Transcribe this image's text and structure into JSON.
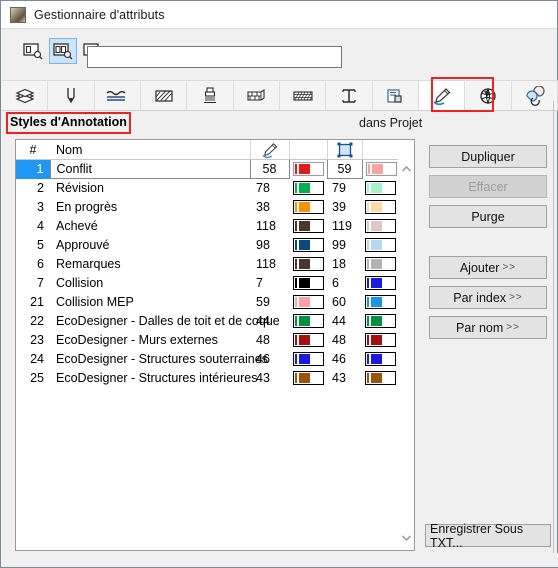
{
  "window": {
    "title": "Gestionnaire d'attributs",
    "app_icon": "archicad-icon"
  },
  "search": {
    "value": "",
    "placeholder": "",
    "modes": [
      {
        "name": "search-single-icon",
        "active": false
      },
      {
        "name": "search-double-icon",
        "active": true
      },
      {
        "name": "search-right-icon",
        "active": false
      }
    ]
  },
  "toolbar": {
    "items": [
      {
        "name": "layers-icon",
        "selected": false
      },
      {
        "name": "pen-icon",
        "selected": false
      },
      {
        "name": "line-type-icon",
        "selected": false
      },
      {
        "name": "fill-icon",
        "selected": false
      },
      {
        "name": "surface-brush-icon",
        "selected": false
      },
      {
        "name": "building-material-icon",
        "selected": false
      },
      {
        "name": "composite-icon",
        "selected": false
      },
      {
        "name": "profile-icon",
        "selected": false
      },
      {
        "name": "zone-category-icon",
        "selected": false
      },
      {
        "name": "annotation-style-icon",
        "selected": true
      },
      {
        "name": "mep-system-icon",
        "selected": false
      },
      {
        "name": "renovation-filter-icon",
        "selected": false
      }
    ],
    "highlight_index": 9
  },
  "section": {
    "caption": "Styles d'Annotation",
    "scope": "dans Projet"
  },
  "table": {
    "headers": {
      "number": "#",
      "name": "Nom",
      "pen_icon": "pen-marker-icon",
      "pen_swatch": "",
      "selection_icon": "marquee-icon",
      "selection_swatch": ""
    },
    "rows": [
      {
        "num": "1",
        "name": "Conflit",
        "idx": "58",
        "sw": "#e31a1a",
        "pen": "#e31a1a",
        "idx2": "59",
        "sw2": "#f9a3a3",
        "pen2": "#f9a3a3",
        "selected": true
      },
      {
        "num": "2",
        "name": "Révision",
        "idx": "78",
        "sw": "#00b050",
        "pen": "#00b050",
        "idx2": "79",
        "sw2": "#a8f0c8",
        "pen2": "#a8f0c8",
        "selected": false
      },
      {
        "num": "3",
        "name": "En progrès",
        "idx": "38",
        "sw": "#f79200",
        "pen": "#f79200",
        "idx2": "39",
        "sw2": "#fbd9a8",
        "pen2": "#fbd9a8",
        "selected": false
      },
      {
        "num": "4",
        "name": "Achevé",
        "idx": "118",
        "sw": "#4a3530",
        "pen": "#4a3530",
        "idx2": "119",
        "sw2": "#dcc8c6",
        "pen2": "#dcc8c6",
        "selected": false
      },
      {
        "num": "5",
        "name": "Approuvé",
        "idx": "98",
        "sw": "#054c7c",
        "pen": "#054c7c",
        "idx2": "99",
        "sw2": "#b4d8f2",
        "pen2": "#b4d8f2",
        "selected": false
      },
      {
        "num": "6",
        "name": "Remarques",
        "idx": "118",
        "sw": "#4a3530",
        "pen": "#4a3530",
        "idx2": "18",
        "sw2": "#b3b3b3",
        "pen2": "#b3b3b3",
        "selected": false
      },
      {
        "num": "7",
        "name": "Collision",
        "idx": "7",
        "sw": "#000000",
        "pen": "#000000",
        "idx2": "6",
        "sw2": "#1a1ae0",
        "pen2": "#1a1ae0",
        "selected": false
      },
      {
        "num": "21",
        "name": "Collision MEP",
        "idx": "59",
        "sw": "#f9a3a3",
        "pen": "#f9a3a3",
        "idx2": "60",
        "sw2": "#1f92e8",
        "pen2": "#1f92e8",
        "selected": false
      },
      {
        "num": "22",
        "name": "EcoDesigner - Dalles de toit et de coque",
        "idx": "44",
        "sw": "#009040",
        "pen": "#009040",
        "idx2": "44",
        "sw2": "#009040",
        "pen2": "#009040",
        "selected": false
      },
      {
        "num": "23",
        "name": "EcoDesigner - Murs externes",
        "idx": "48",
        "sw": "#a81010",
        "pen": "#a81010",
        "idx2": "48",
        "sw2": "#a81010",
        "pen2": "#a81010",
        "selected": false
      },
      {
        "num": "24",
        "name": "EcoDesigner - Structures souterraines",
        "idx": "46",
        "sw": "#1a1ae0",
        "pen": "#1a1ae0",
        "idx2": "46",
        "sw2": "#1a1ae0",
        "pen2": "#1a1ae0",
        "selected": false
      },
      {
        "num": "25",
        "name": "EcoDesigner - Structures intérieures",
        "idx": "43",
        "sw": "#9a5410",
        "pen": "#9a5410",
        "idx2": "43",
        "sw2": "#9a5410",
        "pen2": "#9a5410",
        "selected": false
      }
    ]
  },
  "buttons": {
    "duplicate": "Dupliquer",
    "delete": "Effacer",
    "purge": "Purge",
    "add": "Ajouter",
    "by_index": "Par index",
    "by_name": "Par nom",
    "arrows": ">>",
    "save_as_txt": "Enregistrer Sous TXT..."
  },
  "colors": {
    "selection_blue": "#2196f3",
    "highlight_red": "#ee2222",
    "toolbar_active": "#cce4f7"
  }
}
